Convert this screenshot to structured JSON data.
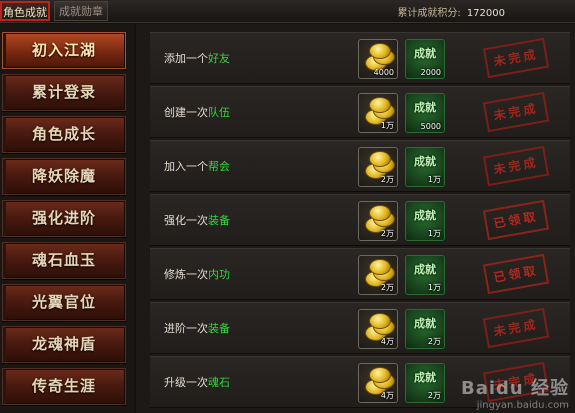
{
  "tabs": [
    {
      "label": "角色成就",
      "active": true
    },
    {
      "label": "成就勋章",
      "active": false
    }
  ],
  "score": {
    "label": "累计成就积分:",
    "value": "172000"
  },
  "sidebar": {
    "items": [
      {
        "label": "初入江湖",
        "active": true
      },
      {
        "label": "累计登录"
      },
      {
        "label": "角色成长"
      },
      {
        "label": "降妖除魔"
      },
      {
        "label": "强化进阶"
      },
      {
        "label": "魂石血玉"
      },
      {
        "label": "光翼官位"
      },
      {
        "label": "龙魂神盾"
      },
      {
        "label": "传奇生涯"
      }
    ]
  },
  "achievements": [
    {
      "prefix": "添加一个",
      "keyword": "好友",
      "gold": "4000",
      "points": "2000",
      "ach_label": "成就",
      "status": "未完成"
    },
    {
      "prefix": "创建一次",
      "keyword": "队伍",
      "gold": "1万",
      "points": "5000",
      "ach_label": "成就",
      "status": "未完成"
    },
    {
      "prefix": "加入一个",
      "keyword": "帮会",
      "gold": "2万",
      "points": "1万",
      "ach_label": "成就",
      "status": "未完成"
    },
    {
      "prefix": "强化一次",
      "keyword": "装备",
      "gold": "2万",
      "points": "1万",
      "ach_label": "成就",
      "status": "已领取"
    },
    {
      "prefix": "修炼一次",
      "keyword": "内功",
      "gold": "2万",
      "points": "1万",
      "ach_label": "成就",
      "status": "已领取"
    },
    {
      "prefix": "进阶一次",
      "keyword": "装备",
      "gold": "4万",
      "points": "2万",
      "ach_label": "成就",
      "status": "未完成"
    },
    {
      "prefix": "升级一次",
      "keyword": "魂石",
      "gold": "4万",
      "points": "2万",
      "ach_label": "成就",
      "status": "未完成"
    }
  ],
  "watermark": {
    "brand": "Baidu 经验",
    "url": "jingyan.baidu.com"
  },
  "colors": {
    "keyword": "#34d63e",
    "stamp": "#b4281c",
    "active_tab_border": "#c0221b"
  }
}
